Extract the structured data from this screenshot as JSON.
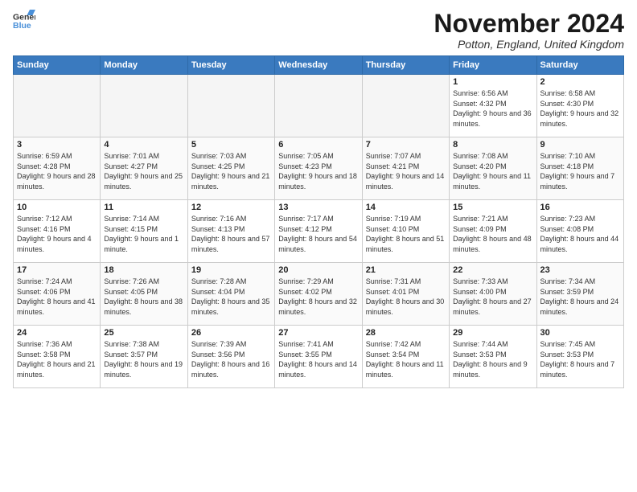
{
  "logo": {
    "line1": "General",
    "line2": "Blue"
  },
  "title": "November 2024",
  "location": "Potton, England, United Kingdom",
  "days_of_week": [
    "Sunday",
    "Monday",
    "Tuesday",
    "Wednesday",
    "Thursday",
    "Friday",
    "Saturday"
  ],
  "weeks": [
    [
      {
        "day": "",
        "empty": true
      },
      {
        "day": "",
        "empty": true
      },
      {
        "day": "",
        "empty": true
      },
      {
        "day": "",
        "empty": true
      },
      {
        "day": "",
        "empty": true
      },
      {
        "day": "1",
        "sunrise": "6:56 AM",
        "sunset": "4:32 PM",
        "daylight": "9 hours and 36 minutes."
      },
      {
        "day": "2",
        "sunrise": "6:58 AM",
        "sunset": "4:30 PM",
        "daylight": "9 hours and 32 minutes."
      }
    ],
    [
      {
        "day": "3",
        "sunrise": "6:59 AM",
        "sunset": "4:28 PM",
        "daylight": "9 hours and 28 minutes."
      },
      {
        "day": "4",
        "sunrise": "7:01 AM",
        "sunset": "4:27 PM",
        "daylight": "9 hours and 25 minutes."
      },
      {
        "day": "5",
        "sunrise": "7:03 AM",
        "sunset": "4:25 PM",
        "daylight": "9 hours and 21 minutes."
      },
      {
        "day": "6",
        "sunrise": "7:05 AM",
        "sunset": "4:23 PM",
        "daylight": "9 hours and 18 minutes."
      },
      {
        "day": "7",
        "sunrise": "7:07 AM",
        "sunset": "4:21 PM",
        "daylight": "9 hours and 14 minutes."
      },
      {
        "day": "8",
        "sunrise": "7:08 AM",
        "sunset": "4:20 PM",
        "daylight": "9 hours and 11 minutes."
      },
      {
        "day": "9",
        "sunrise": "7:10 AM",
        "sunset": "4:18 PM",
        "daylight": "9 hours and 7 minutes."
      }
    ],
    [
      {
        "day": "10",
        "sunrise": "7:12 AM",
        "sunset": "4:16 PM",
        "daylight": "9 hours and 4 minutes."
      },
      {
        "day": "11",
        "sunrise": "7:14 AM",
        "sunset": "4:15 PM",
        "daylight": "9 hours and 1 minute."
      },
      {
        "day": "12",
        "sunrise": "7:16 AM",
        "sunset": "4:13 PM",
        "daylight": "8 hours and 57 minutes."
      },
      {
        "day": "13",
        "sunrise": "7:17 AM",
        "sunset": "4:12 PM",
        "daylight": "8 hours and 54 minutes."
      },
      {
        "day": "14",
        "sunrise": "7:19 AM",
        "sunset": "4:10 PM",
        "daylight": "8 hours and 51 minutes."
      },
      {
        "day": "15",
        "sunrise": "7:21 AM",
        "sunset": "4:09 PM",
        "daylight": "8 hours and 48 minutes."
      },
      {
        "day": "16",
        "sunrise": "7:23 AM",
        "sunset": "4:08 PM",
        "daylight": "8 hours and 44 minutes."
      }
    ],
    [
      {
        "day": "17",
        "sunrise": "7:24 AM",
        "sunset": "4:06 PM",
        "daylight": "8 hours and 41 minutes."
      },
      {
        "day": "18",
        "sunrise": "7:26 AM",
        "sunset": "4:05 PM",
        "daylight": "8 hours and 38 minutes."
      },
      {
        "day": "19",
        "sunrise": "7:28 AM",
        "sunset": "4:04 PM",
        "daylight": "8 hours and 35 minutes."
      },
      {
        "day": "20",
        "sunrise": "7:29 AM",
        "sunset": "4:02 PM",
        "daylight": "8 hours and 32 minutes."
      },
      {
        "day": "21",
        "sunrise": "7:31 AM",
        "sunset": "4:01 PM",
        "daylight": "8 hours and 30 minutes."
      },
      {
        "day": "22",
        "sunrise": "7:33 AM",
        "sunset": "4:00 PM",
        "daylight": "8 hours and 27 minutes."
      },
      {
        "day": "23",
        "sunrise": "7:34 AM",
        "sunset": "3:59 PM",
        "daylight": "8 hours and 24 minutes."
      }
    ],
    [
      {
        "day": "24",
        "sunrise": "7:36 AM",
        "sunset": "3:58 PM",
        "daylight": "8 hours and 21 minutes."
      },
      {
        "day": "25",
        "sunrise": "7:38 AM",
        "sunset": "3:57 PM",
        "daylight": "8 hours and 19 minutes."
      },
      {
        "day": "26",
        "sunrise": "7:39 AM",
        "sunset": "3:56 PM",
        "daylight": "8 hours and 16 minutes."
      },
      {
        "day": "27",
        "sunrise": "7:41 AM",
        "sunset": "3:55 PM",
        "daylight": "8 hours and 14 minutes."
      },
      {
        "day": "28",
        "sunrise": "7:42 AM",
        "sunset": "3:54 PM",
        "daylight": "8 hours and 11 minutes."
      },
      {
        "day": "29",
        "sunrise": "7:44 AM",
        "sunset": "3:53 PM",
        "daylight": "8 hours and 9 minutes."
      },
      {
        "day": "30",
        "sunrise": "7:45 AM",
        "sunset": "3:53 PM",
        "daylight": "8 hours and 7 minutes."
      }
    ]
  ],
  "labels": {
    "sunrise": "Sunrise:",
    "sunset": "Sunset:",
    "daylight": "Daylight:"
  }
}
